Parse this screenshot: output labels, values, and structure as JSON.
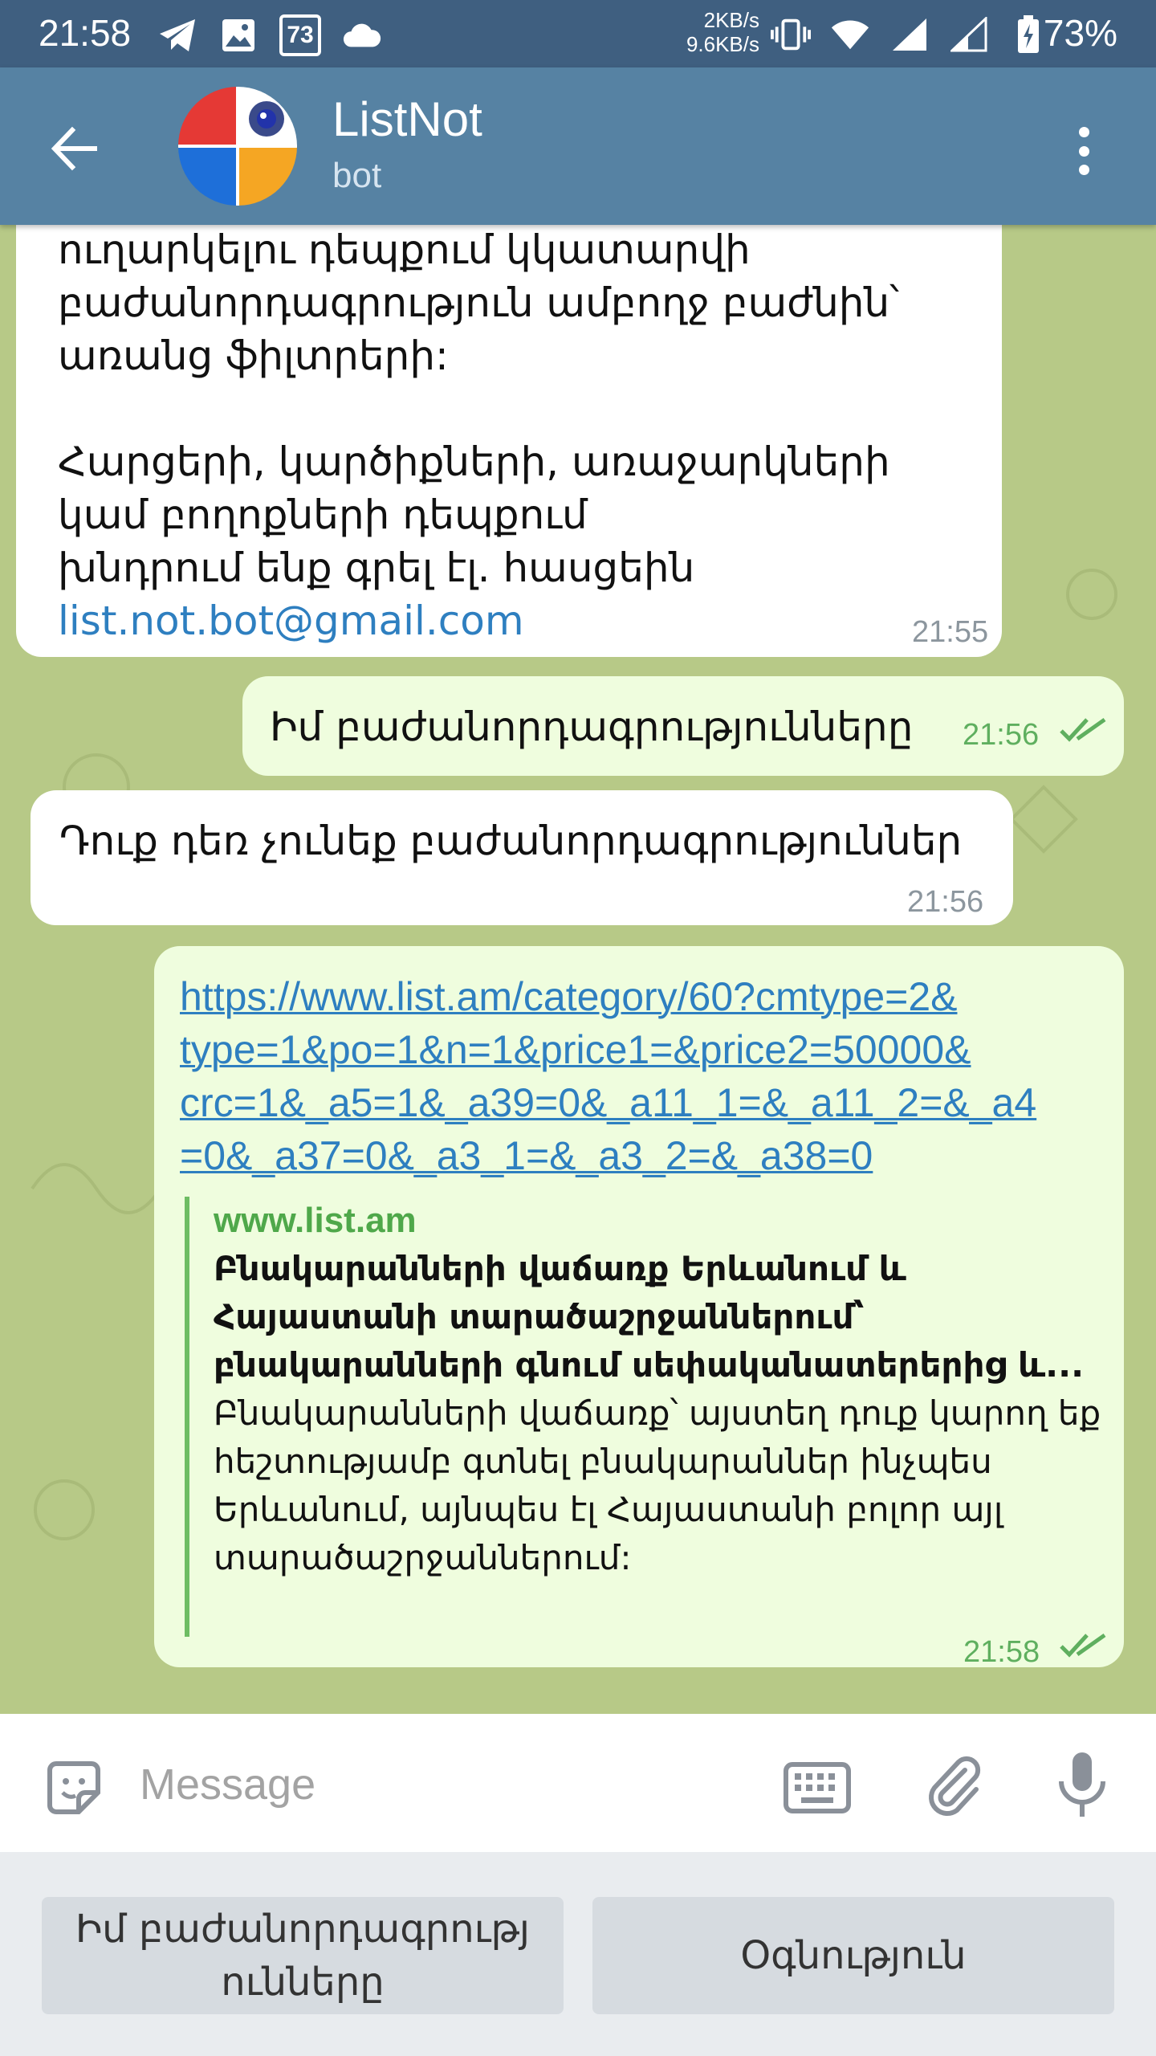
{
  "status_bar": {
    "time": "21:58",
    "notification_badge": "73",
    "net_speed_up": "2KB/s",
    "net_speed_down": "9.6KB/s",
    "battery_percent": "73%"
  },
  "header": {
    "title": "ListNot",
    "subtitle": "bot"
  },
  "messages": [
    {
      "direction": "incoming",
      "text": "ուղարկելու դեպքում կկատարվի\nբաժանորդագրություն ամբողջ բաժնին՝\nառանց ֆիլտրերի:\n\nՀարցերի, կարծիքների, առաջարկների\nկամ բողոքների դեպքում\nխնդրում ենք գրել էլ. հասցեին",
      "email": "list.not.bot@gmail.com",
      "time": "21:55"
    },
    {
      "direction": "outgoing",
      "text": "Իմ բաժանորդագրությունները",
      "time": "21:56",
      "status": "read"
    },
    {
      "direction": "incoming",
      "text": "Դուք դեռ չունեք բաժանորդագրություններ",
      "time": "21:56"
    },
    {
      "direction": "outgoing",
      "link": "https://www.list.am/category/60?cmtype=2&type=1&po=1&n=1&price1=&price2=50000&crc=1&_a5=1&_a39=0&_a11_1=&_a11_2=&_a4=0&_a37=0&_a3_1=&_a3_2=&_a38=0",
      "link_lines": [
        "https://www.list.am/category/60?cmtype=2&",
        "type=1&po=1&n=1&price1=&price2=50000&",
        "crc=1&_a5=1&_a39=0&_a11_1=&_a11_2=&_a4",
        "=0&_a37=0&_a3_1=&_a3_2=&_a38=0"
      ],
      "preview": {
        "site": "www.list.am",
        "title": "Բնակարանների վաճառք Երևանում և Հայաստանի տարածաշրջաններում՝ բնակարանների գնում սեփականատերերից և...",
        "description": "Բնակարանների վաճառք՝ այստեղ դուք կարող եք հեշտությամբ գտնել բնակարաններ ինչպես Երևանում,  այնպես էլ Հայաստանի բոլոր այլ տարածաշրջաններում:"
      },
      "time": "21:58",
      "status": "read"
    }
  ],
  "input": {
    "placeholder": "Message"
  },
  "bot_keyboard": {
    "buttons": [
      "Իմ բաժանորդագրությ ունները",
      "Օգնություն"
    ]
  },
  "icons": {
    "back": "arrow-left-icon",
    "menu": "more-vertical-icon",
    "emoji": "sticker-emoji-icon",
    "keyboard": "keyboard-icon",
    "attach": "paperclip-icon",
    "mic": "microphone-icon"
  },
  "colors": {
    "header": "#5682a3",
    "status_bar": "#3f5f80",
    "chat_bg": "#b7c987",
    "outgoing_bubble": "#effdde",
    "incoming_bubble": "#ffffff",
    "link": "#2e7fc0",
    "read_tick": "#5faf5f"
  }
}
